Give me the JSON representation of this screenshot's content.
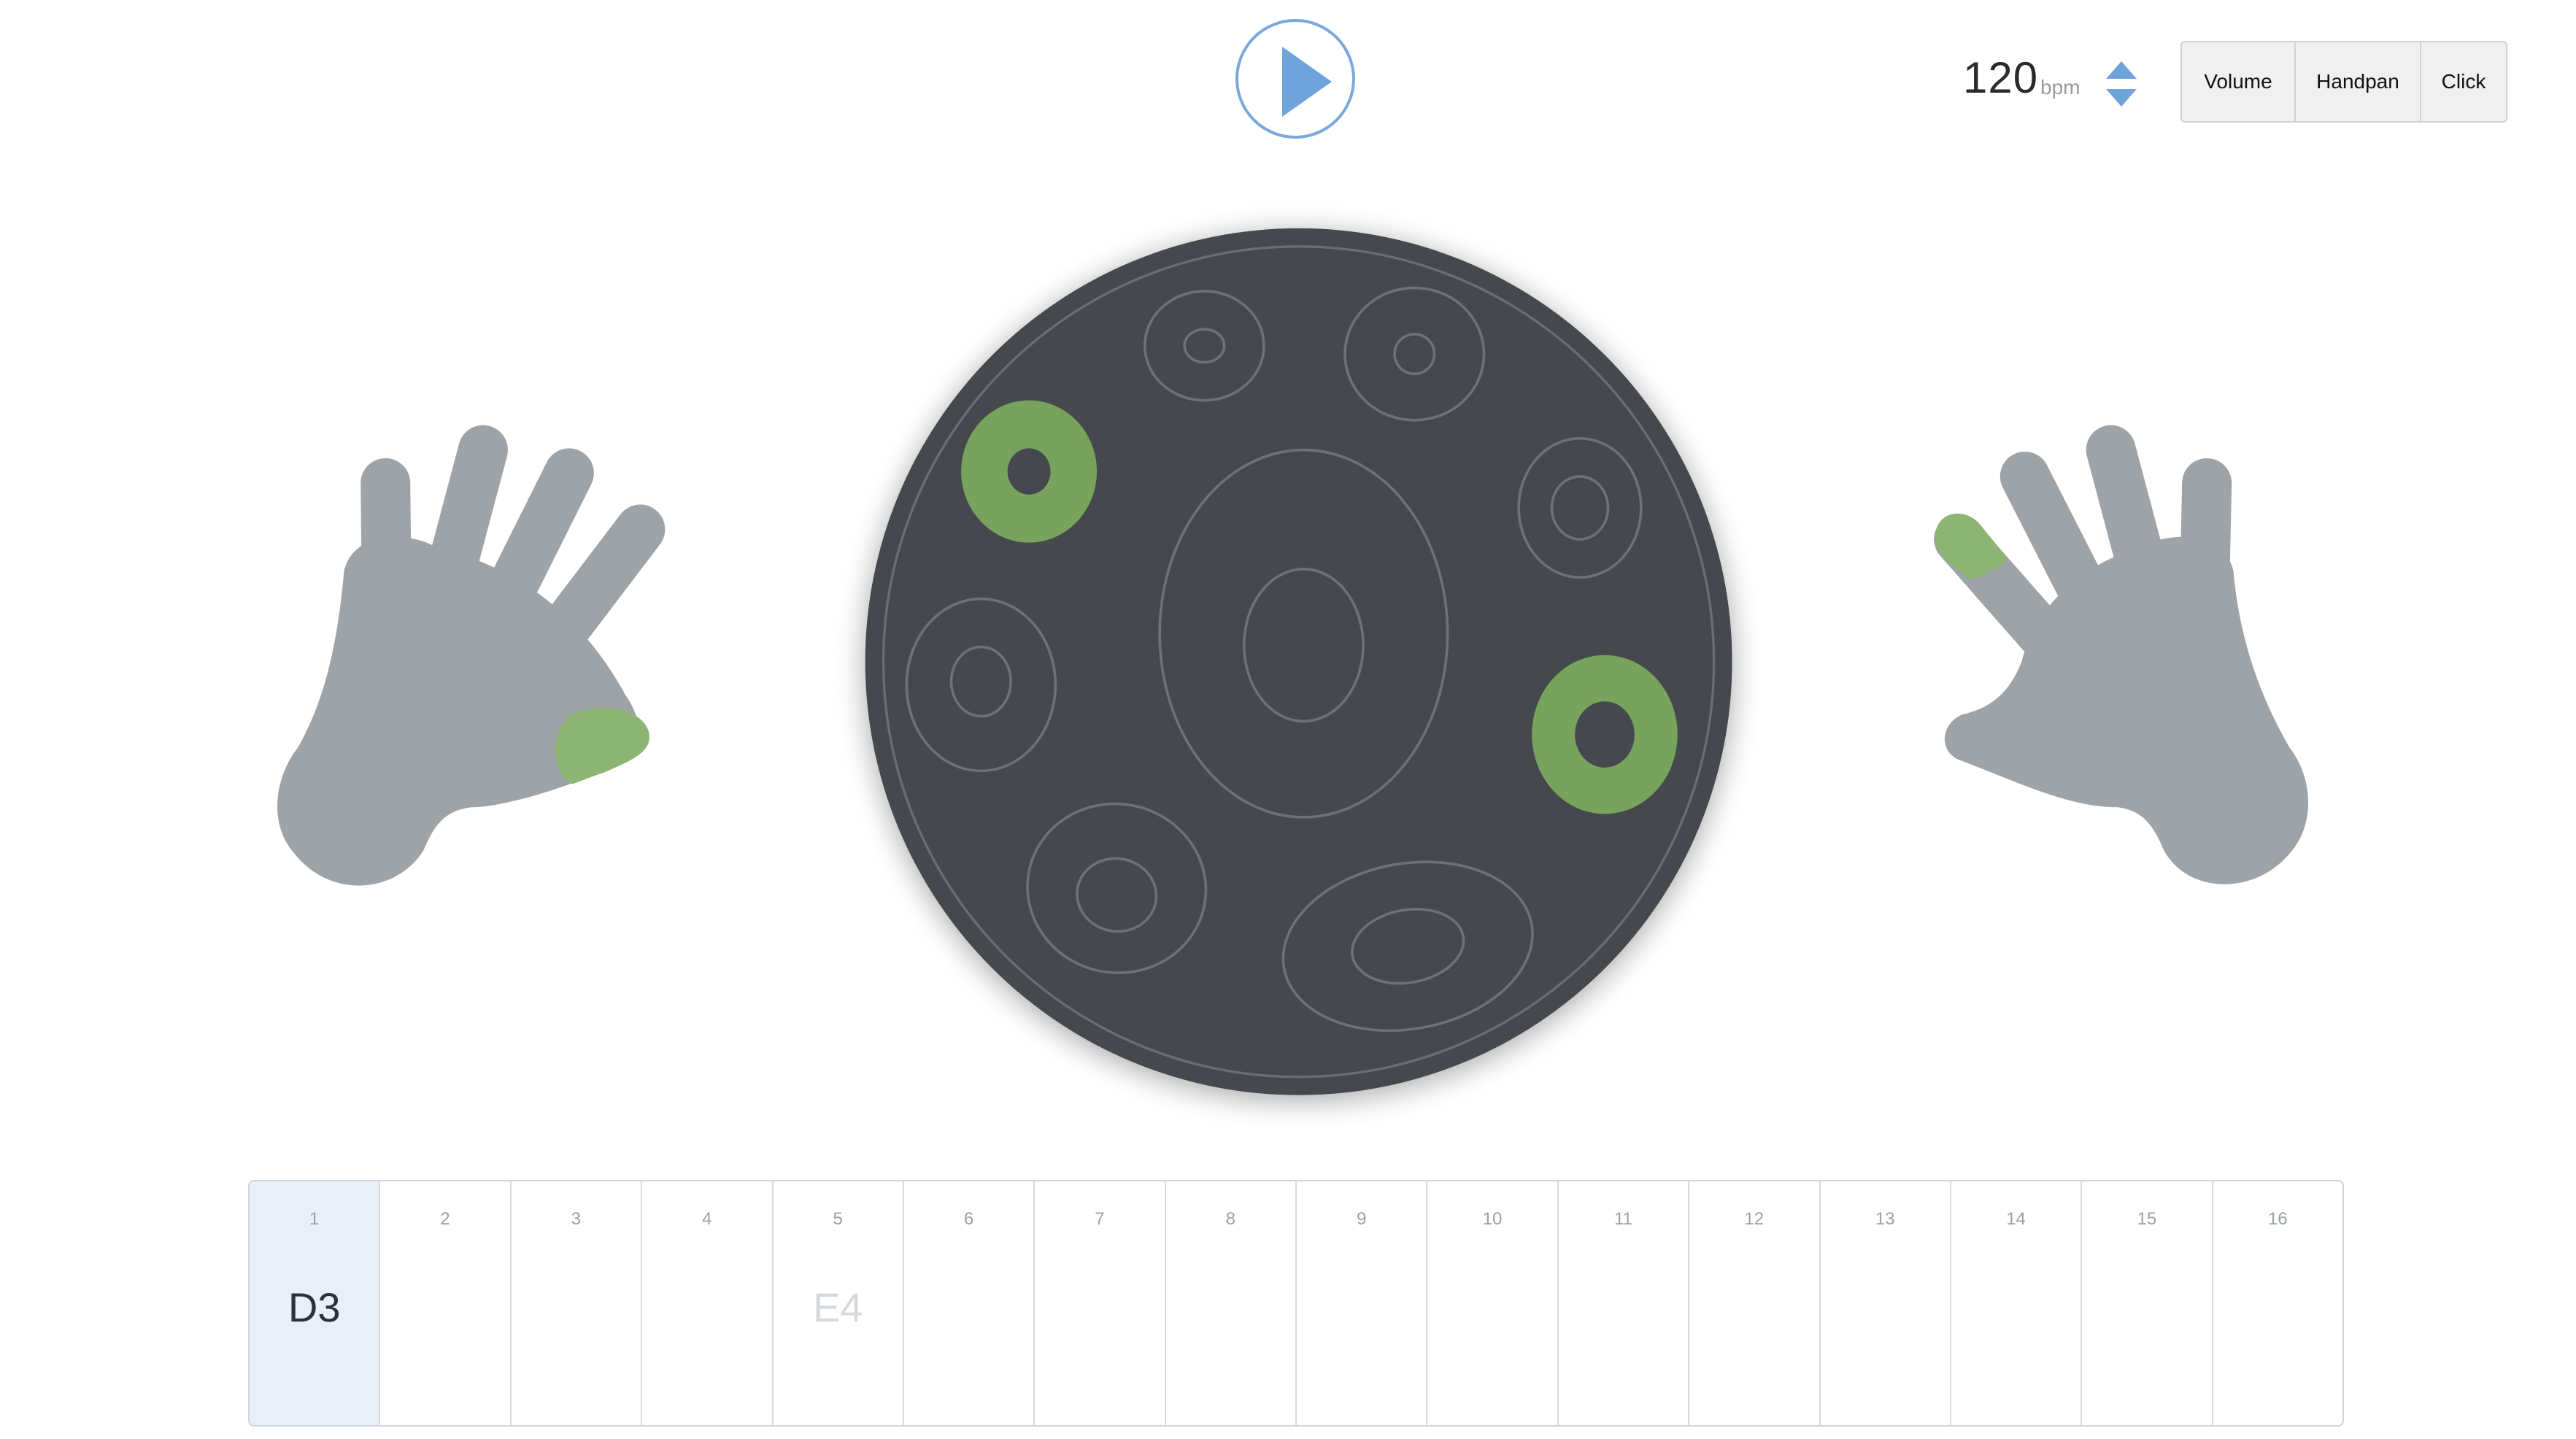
{
  "transport": {
    "play_icon": "play-icon",
    "accent": "#6fa3dc"
  },
  "tempo": {
    "value": "120",
    "unit": "bpm",
    "up_icon": "triangle-up-icon",
    "down_icon": "triangle-down-icon"
  },
  "toolbar": {
    "volume_label": "Volume",
    "handpan_label": "Handpan",
    "click_label": "Click"
  },
  "colors": {
    "hand": "#9ea3a8",
    "drum": "#45484e",
    "note_ring": "#6e7277",
    "highlight": "#78a35c",
    "active_step": "#e8eff8"
  },
  "hands": {
    "left": {
      "icon": "left-hand-icon",
      "highlighted_finger": "thumb"
    },
    "right": {
      "icon": "right-hand-icon",
      "highlighted_finger": "index"
    }
  },
  "handpan": {
    "icon": "handpan-drum",
    "highlighted_notes": [
      "tone-field-top-left",
      "tone-field-right"
    ]
  },
  "sequencer": {
    "steps": [
      {
        "num": "1",
        "note": "D3",
        "active": true
      },
      {
        "num": "2",
        "note": ""
      },
      {
        "num": "3",
        "note": ""
      },
      {
        "num": "4",
        "note": ""
      },
      {
        "num": "5",
        "note": "E4",
        "dim": true
      },
      {
        "num": "6",
        "note": ""
      },
      {
        "num": "7",
        "note": ""
      },
      {
        "num": "8",
        "note": ""
      },
      {
        "num": "9",
        "note": ""
      },
      {
        "num": "10",
        "note": ""
      },
      {
        "num": "11",
        "note": ""
      },
      {
        "num": "12",
        "note": ""
      },
      {
        "num": "13",
        "note": ""
      },
      {
        "num": "14",
        "note": ""
      },
      {
        "num": "15",
        "note": ""
      },
      {
        "num": "16",
        "note": ""
      }
    ]
  }
}
